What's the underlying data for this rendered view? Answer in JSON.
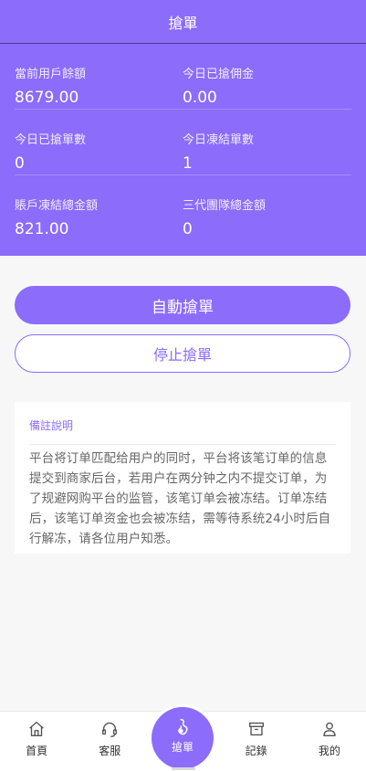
{
  "header": {
    "title": "搶單"
  },
  "stats": {
    "rows": [
      [
        {
          "label": "當前用戶餘額",
          "value": "8679.00"
        },
        {
          "label": "今日已搶佣金",
          "value": "0.00"
        }
      ],
      [
        {
          "label": "今日已搶單數",
          "value": "0"
        },
        {
          "label": "今日凍結單數",
          "value": "1"
        }
      ],
      [
        {
          "label": "賬戶凍結總金額",
          "value": "821.00"
        },
        {
          "label": "三代團隊總金額",
          "value": "0"
        }
      ]
    ]
  },
  "actions": {
    "auto_label": "自動搶單",
    "stop_label": "停止搶單"
  },
  "notes": {
    "title": "備註說明",
    "body": "平台将订单匹配给用户的同时，平台将该笔订单的信息提交到商家后台，若用户在两分钟之内不提交订单，为了规避网购平台的监管，该笔订单会被冻结。订单冻结后，该笔订单资金也会被冻结，需等待系统24小时后自行解冻，请各位用户知悉。"
  },
  "tabbar": {
    "items": [
      {
        "label": "首頁",
        "icon": "home-icon"
      },
      {
        "label": "客服",
        "icon": "headset-icon"
      },
      {
        "label": "搶單",
        "icon": "grab-icon"
      },
      {
        "label": "記錄",
        "icon": "archive-icon"
      },
      {
        "label": "我的",
        "icon": "user-icon"
      }
    ]
  },
  "colors": {
    "accent": "#8b6cfb",
    "background": "#f7f7f8"
  }
}
